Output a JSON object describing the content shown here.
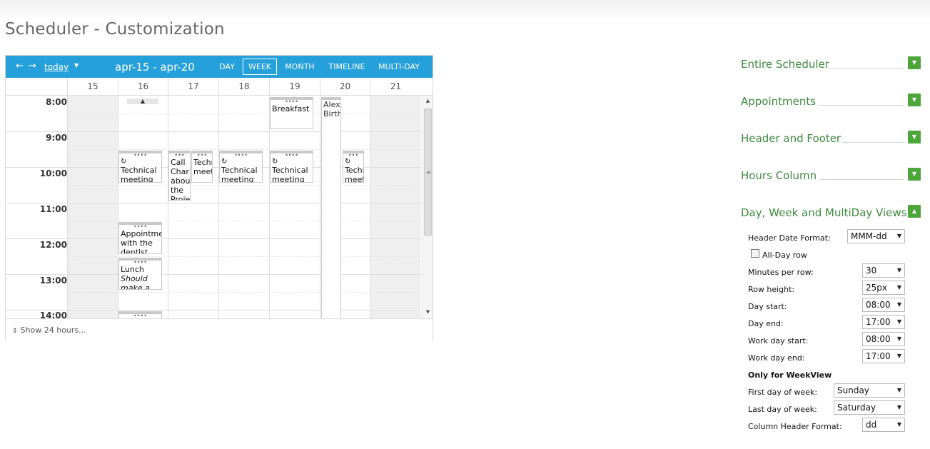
{
  "page": {
    "title": "Scheduler - Customization"
  },
  "toolbar": {
    "prev_icon": "arrow-left-icon",
    "next_icon": "arrow-right-icon",
    "today_label": "today",
    "date_range": "apr-15 - apr-20",
    "views": [
      "DAY",
      "WEEK",
      "MONTH",
      "TIMELINE",
      "MULTI-DAY"
    ],
    "active_view": "WEEK"
  },
  "days": [
    "15",
    "16",
    "17",
    "18",
    "19",
    "20",
    "21"
  ],
  "hours": [
    "8:00",
    "9:00",
    "10:00",
    "11:00",
    "12:00",
    "13:00",
    "14:00"
  ],
  "appointments": {
    "breakfast": "Breakfast",
    "alex": "Alex' Birthday",
    "call": "Call Charlie about the Project",
    "tech": "Technical meeting",
    "tech_short": "Technical meeting",
    "dentist": "Appointment with the dentist",
    "lunch_title": "Lunch",
    "lunch_sub": "Should make a reservation"
  },
  "footer": {
    "show24": "Show 24 hours..."
  },
  "panel": {
    "sections": {
      "entire": "Entire Scheduler",
      "appointments": "Appointments",
      "header_footer": "Header and Footer",
      "hours_column": "Hours Column",
      "day_week": "Day, Week and MultiDay Views"
    },
    "options": {
      "header_date_format": {
        "label": "Header Date Format:",
        "value": "MMM-dd"
      },
      "all_day_row": {
        "label": "All-Day row",
        "checked": false
      },
      "minutes_per_row": {
        "label": "Minutes per row:",
        "value": "30"
      },
      "row_height": {
        "label": "Row height:",
        "value": "25px"
      },
      "day_start": {
        "label": "Day start:",
        "value": "08:00"
      },
      "day_end": {
        "label": "Day end:",
        "value": "17:00"
      },
      "work_day_start": {
        "label": "Work day start:",
        "value": "08:00"
      },
      "work_day_end": {
        "label": "Work day end:",
        "value": "17:00"
      },
      "week_only_title": "Only for WeekView",
      "first_day": {
        "label": "First day of week:",
        "value": "Sunday"
      },
      "last_day": {
        "label": "Last day of week:",
        "value": "Saturday"
      },
      "column_header_format": {
        "label": "Column Header Format:",
        "value": "dd"
      }
    }
  },
  "colors": {
    "toolbar": "#25a0da",
    "accent_green": "#4ca63a",
    "section_text": "#3f8a3f"
  }
}
